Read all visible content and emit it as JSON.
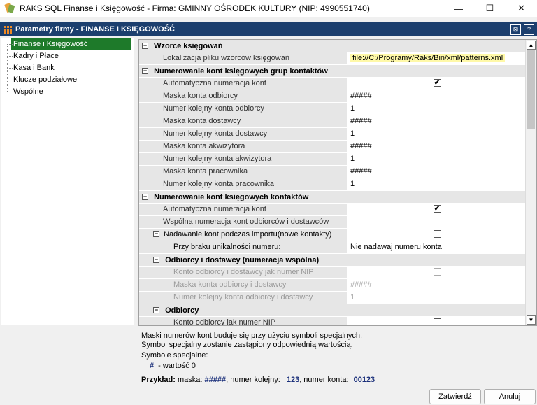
{
  "window": {
    "title": "RAKS SQL Finanse i Księgowość - Firma: GMINNY OŚRODEK KULTURY (NIP: 4990551740)",
    "minimize": "—",
    "maximize": "☐",
    "close": "✕"
  },
  "dialog": {
    "title": "Parametry firmy - FINANSE I KSIĘGOWOŚĆ",
    "icon_btn1": "⊠",
    "icon_btn2": "?"
  },
  "tree": {
    "items": [
      {
        "label": "Finanse i Księgowość",
        "selected": true
      },
      {
        "label": "Kadry i Płace"
      },
      {
        "label": "Kasa i Bank"
      },
      {
        "label": "Klucze podziałowe"
      },
      {
        "label": "Wspólne"
      }
    ]
  },
  "grid": {
    "cat1": "Wzorce księgowań",
    "cat1_rows": [
      {
        "name": "Lokalizacja pliku wzorców księgowań",
        "value": "file://C:/Programy/Raks/Bin/xml/patterns.xml"
      }
    ],
    "cat2": "Numerowanie kont księgowych grup kontaktów",
    "cat2_rows": [
      {
        "name": "Automatyczna numeracja kont",
        "value": "✔"
      },
      {
        "name": "Maska konta odbiorcy",
        "value": "#####"
      },
      {
        "name": "Numer kolejny konta odbiorcy",
        "value": "1"
      },
      {
        "name": "Maska konta dostawcy",
        "value": "#####"
      },
      {
        "name": "Numer kolejny konta dostawcy",
        "value": "1"
      },
      {
        "name": "Maska konta akwizytora",
        "value": "#####"
      },
      {
        "name": "Numer kolejny konta akwizytora",
        "value": "1"
      },
      {
        "name": "Maska konta pracownika",
        "value": "#####"
      },
      {
        "name": "Numer kolejny konta pracownika",
        "value": "1"
      }
    ],
    "cat3": "Numerowanie kont księgowych kontaktów",
    "cat3_rows": [
      {
        "name": "Automatyczna numeracja kont",
        "value": "✔"
      },
      {
        "name": "Wspólna numeracja kont odbiorców i dostawców",
        "value": ""
      }
    ],
    "sub1": "Nadawanie kont podczas importu(nowe kontakty)",
    "sub1_value": "",
    "sub1_rows": [
      {
        "name": "Przy braku unikalności numeru:",
        "value": "Nie nadawaj numeru konta"
      }
    ],
    "sub2": "Odbiorcy i dostawcy (numeracja wspólna)",
    "sub2_rows": [
      {
        "name": "Konto odbiorcy i dostawcy jak numer NIP",
        "value": ""
      },
      {
        "name": "Maska konta odbiorcy i dostawcy",
        "value": "#####"
      },
      {
        "name": "Numer kolejny konta odbiorcy i dostawcy",
        "value": "1"
      }
    ],
    "sub3": "Odbiorcy",
    "sub3_rows": [
      {
        "name": "Konto odbiorcy jak numer NIP",
        "value": ""
      }
    ]
  },
  "description": {
    "line1": "Maski numerów kont buduje się przy użyciu symboli specjalnych.",
    "line2": "Symbol specjalny zostanie zastąpiony odpowiednią wartością.",
    "line3": "Symbole specjalne:",
    "symbol": "#",
    "symbol_desc": "- wartość 0",
    "example_label": "Przykład:",
    "example_mask_label": "maska:",
    "example_mask": "#####",
    "example_num_label": ", numer kolejny:",
    "example_num": "123",
    "example_acc_label": ", numer konta:",
    "example_acc": "00123"
  },
  "buttons": {
    "ok": "Zatwierdź",
    "cancel": "Anuluj"
  }
}
